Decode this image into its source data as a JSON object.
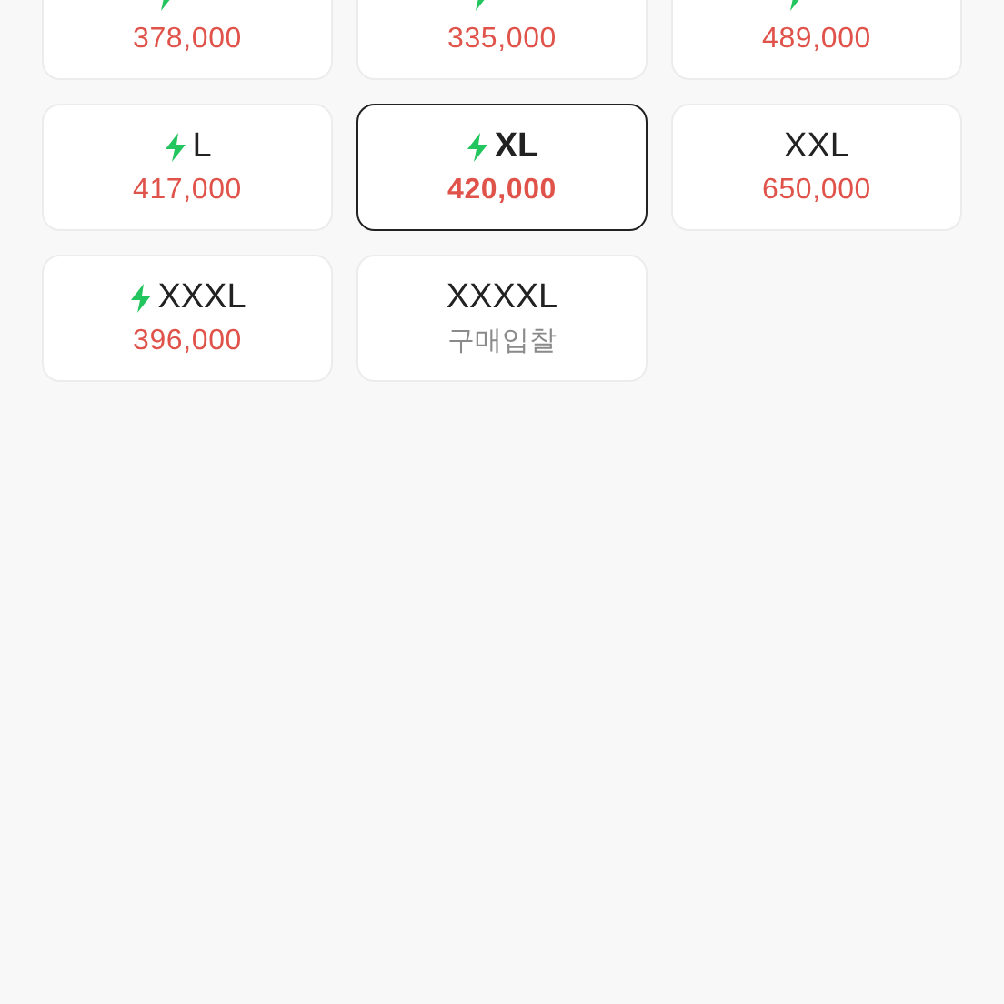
{
  "sizes": [
    {
      "fast": true,
      "selected": false,
      "price": "378,000",
      "kind": "price"
    },
    {
      "fast": true,
      "selected": false,
      "price": "335,000",
      "kind": "price"
    },
    {
      "fast": true,
      "selected": false,
      "price": "489,000",
      "kind": "price"
    },
    {
      "size": "L",
      "fast": true,
      "selected": false,
      "price": "417,000",
      "kind": "price"
    },
    {
      "size": "XL",
      "fast": true,
      "selected": true,
      "price": "420,000",
      "kind": "price"
    },
    {
      "size": "XXL",
      "fast": false,
      "selected": false,
      "price": "650,000",
      "kind": "price"
    },
    {
      "size": "XXXL",
      "fast": true,
      "selected": false,
      "price": "396,000",
      "kind": "price"
    },
    {
      "size": "XXXXL",
      "fast": false,
      "selected": false,
      "price": "구매입찰",
      "kind": "bid"
    }
  ]
}
